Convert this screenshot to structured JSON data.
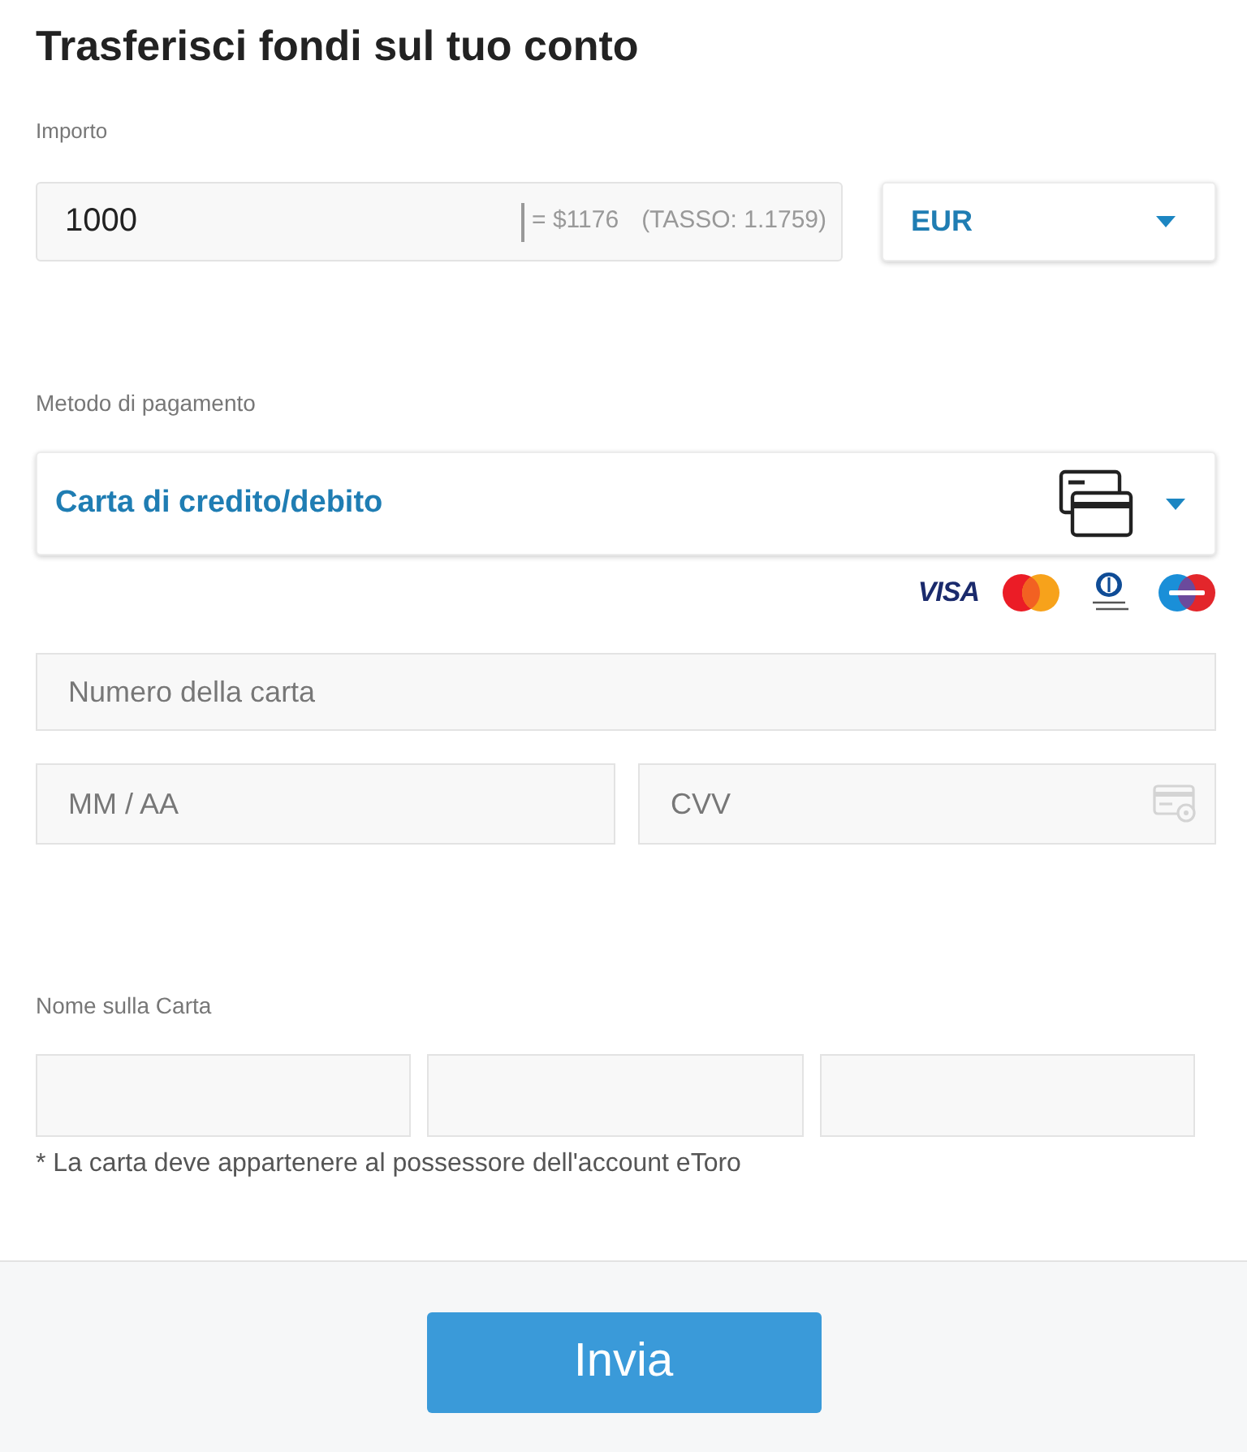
{
  "title": "Trasferisci fondi sul tuo conto",
  "amount": {
    "label": "Importo",
    "value": "1000",
    "conversion": "= $1176",
    "rate": "(TASSO: 1.1759)"
  },
  "currency": {
    "value": "EUR"
  },
  "payment_method": {
    "label": "Metodo di pagamento",
    "value": "Carta di credito/debito"
  },
  "card_brands": [
    {
      "kind": "visa",
      "text": "VISA"
    },
    {
      "kind": "mastercard"
    },
    {
      "kind": "diners"
    },
    {
      "kind": "maestro"
    }
  ],
  "card_number": {
    "placeholder": "Numero della carta"
  },
  "expiry": {
    "placeholder": "MM / AA"
  },
  "cvv": {
    "placeholder": "CVV"
  },
  "name_on_card": {
    "label": "Nome sulla Carta",
    "fields": [
      {
        "kind": "input"
      },
      {
        "kind": "input"
      },
      {
        "kind": "input"
      }
    ]
  },
  "note": "* La carta deve appartenere al possessore dell'account eToro",
  "submit": {
    "label": "Invia"
  }
}
